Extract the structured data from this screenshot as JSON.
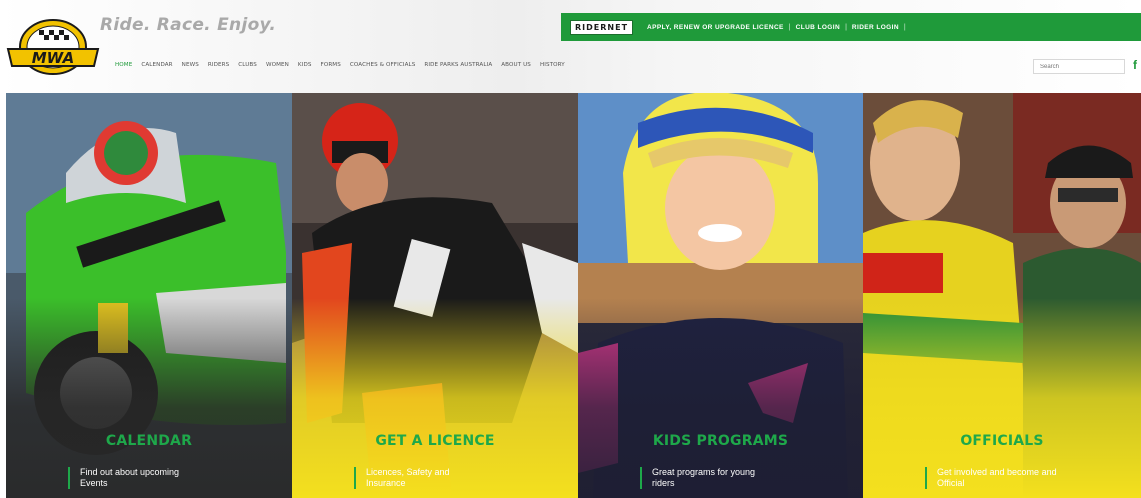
{
  "colors": {
    "brand_green": "#1f9a3a",
    "title_green": "#1ea84a",
    "yellow": "#f4e01e"
  },
  "header": {
    "tagline": "Ride. Race. Enjoy.",
    "logo_text": "MWA",
    "logo_icon": "mwa-logo-icon"
  },
  "topbar": {
    "brand": "RIDERNET",
    "links": [
      "APPLY, RENEW OR UPGRADE LICENCE",
      "CLUB LOGIN",
      "RIDER LOGIN"
    ]
  },
  "nav": {
    "items": [
      "HOME",
      "CALENDAR",
      "NEWS",
      "RIDERS",
      "CLUBS",
      "WOMEN",
      "KIDS",
      "FORMS",
      "COACHES & OFFICIALS",
      "RIDE PARKS AUSTRALIA",
      "ABOUT US",
      "HISTORY"
    ],
    "active": "HOME"
  },
  "search": {
    "placeholder": "Search"
  },
  "social_icon": "facebook-icon",
  "tiles": [
    {
      "title": "CALENDAR",
      "desc_line1": "Find out about upcoming",
      "desc_line2": "Events"
    },
    {
      "title": "GET A LICENCE",
      "desc_line1": "Licences, Safety and",
      "desc_line2": "Insurance"
    },
    {
      "title": "KIDS PROGRAMS",
      "desc_line1": "Great programs for young",
      "desc_line2": "riders"
    },
    {
      "title": "OFFICIALS",
      "desc_line1": "Get involved and become and",
      "desc_line2": "Official"
    }
  ]
}
